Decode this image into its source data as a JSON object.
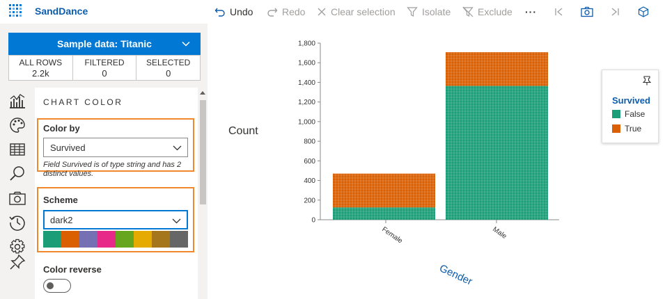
{
  "app": {
    "title": "SandDance"
  },
  "toolbar": {
    "undo": "Undo",
    "redo": "Redo",
    "clear_selection": "Clear selection",
    "isolate": "Isolate",
    "exclude": "Exclude",
    "more": "···"
  },
  "dataset": {
    "label": "Sample data: Titanic"
  },
  "stats": [
    {
      "label": "ALL ROWS",
      "value": "2.2k"
    },
    {
      "label": "FILTERED",
      "value": "0"
    },
    {
      "label": "SELECTED",
      "value": "0"
    }
  ],
  "sidebar": {
    "icons": [
      "chart-icon",
      "palette-icon",
      "table-icon",
      "search-icon",
      "camera-icon",
      "history-icon",
      "settings-icon",
      "pin-icon"
    ]
  },
  "settings": {
    "section_title": "CHART COLOR",
    "color_by_label": "Color by",
    "color_by_value": "Survived",
    "color_by_note": "Field Survived is of type string and has 2 distinct values.",
    "scheme_label": "Scheme",
    "scheme_value": "dark2",
    "scheme_colors": [
      "#1b9e77",
      "#d95f02",
      "#7570b3",
      "#e7298a",
      "#66a61e",
      "#e6ab02",
      "#a6761d",
      "#666666"
    ],
    "reverse_label": "Color reverse",
    "reverse_on": false
  },
  "legend": {
    "title": "Survived",
    "items": [
      {
        "label": "False",
        "color": "#1b9e77"
      },
      {
        "label": "True",
        "color": "#d95f02"
      }
    ]
  },
  "chart_data": {
    "type": "bar",
    "categories": [
      "Female",
      "Male"
    ],
    "series": [
      {
        "name": "False",
        "values": [
          126,
          1364
        ],
        "color": "#1b9e77"
      },
      {
        "name": "True",
        "values": [
          344,
          344
        ],
        "color": "#d95f02"
      }
    ],
    "ylabel": "Count",
    "xlabel": "Gender",
    "ylim": [
      0,
      1800
    ],
    "yticks": [
      0,
      200,
      400,
      600,
      800,
      1000,
      1200,
      1400,
      1600,
      1800
    ],
    "ytick_labels": [
      "0",
      "200",
      "400",
      "600",
      "800",
      "1,000",
      "1,200",
      "1,400",
      "1,600",
      "1,800"
    ]
  }
}
